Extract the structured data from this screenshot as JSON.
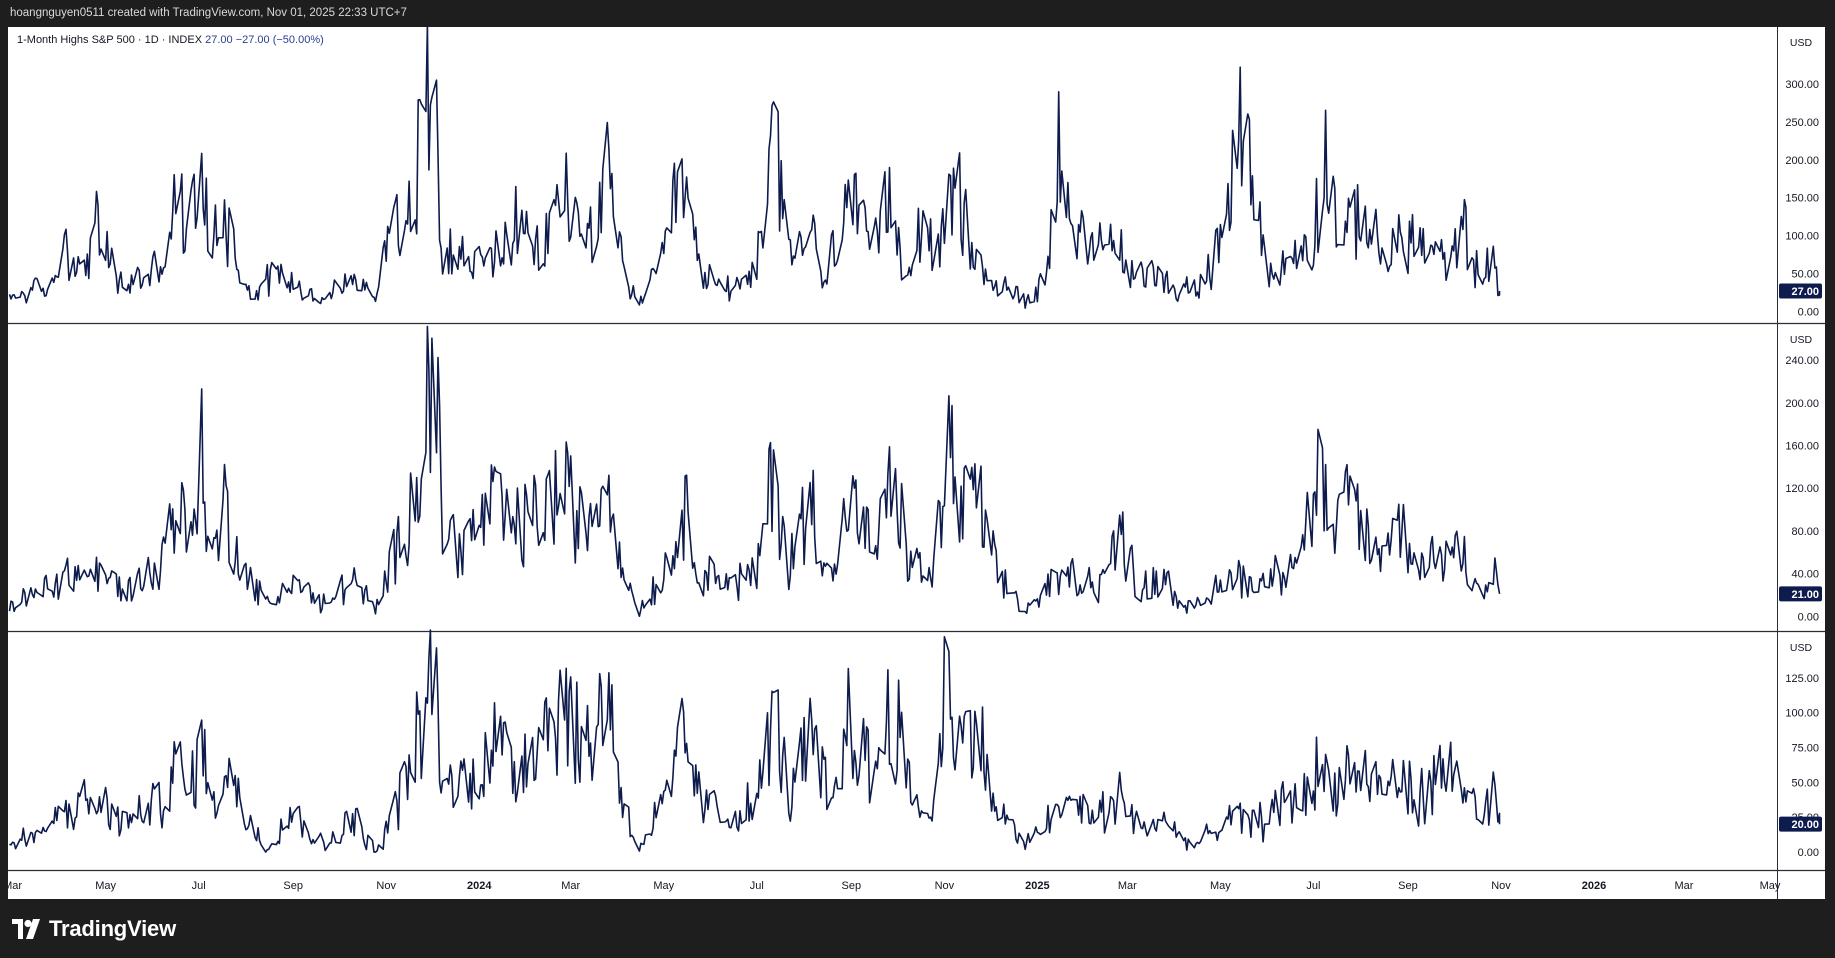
{
  "header": {
    "attribution": "hoangnguyen0511 created with TradingView.com, Nov 01, 2025 22:33 UTC+7"
  },
  "legend": {
    "symbol": "1-Month Highs S&P 500 · 1D · INDEX",
    "last": "27.00",
    "change": "−27.00 (−50.00%)"
  },
  "footer": {
    "brand": "TradingView"
  },
  "colors": {
    "line": "#0d1b4d",
    "price_badge": "#0d1b4d",
    "price_badge_text": "#ffffff",
    "axis_text": "#131722",
    "divider": "#2a2e39",
    "background": "#ffffff",
    "frame": "#1e1e1e"
  },
  "x_axis": {
    "labels": [
      "Mar",
      "May",
      "Jul",
      "Sep",
      "Nov",
      "2024",
      "Mar",
      "May",
      "Jul",
      "Sep",
      "Nov",
      "2025",
      "Mar",
      "May",
      "Jul",
      "Sep",
      "Nov",
      "2026",
      "Mar",
      "May"
    ],
    "bold": [
      "2024",
      "2025",
      "2026"
    ]
  },
  "chart_data": [
    {
      "type": "line",
      "title": "1-Month Highs S&P 500 · 1D · INDEX",
      "currency": "USD",
      "last_value": 27.0,
      "last_value_label": "27.00",
      "ylim": [
        -10,
        370
      ],
      "y_ticks": [
        0,
        50,
        100,
        150,
        200,
        250,
        300
      ],
      "y_tick_labels": [
        "0.00",
        "50.00",
        "100.00",
        "150.00",
        "200.00",
        "250.00",
        "300.00"
      ],
      "anchors": [
        [
          "2023-02-26",
          15
        ],
        [
          "2023-03-12",
          30
        ],
        [
          "2023-03-25",
          25
        ],
        [
          "2023-04-05",
          95
        ],
        [
          "2023-04-15",
          45
        ],
        [
          "2023-04-25",
          110
        ],
        [
          "2023-05-10",
          35
        ],
        [
          "2023-05-28",
          45
        ],
        [
          "2023-06-10",
          75
        ],
        [
          "2023-06-17",
          155
        ],
        [
          "2023-06-25",
          90
        ],
        [
          "2023-07-02",
          240
        ],
        [
          "2023-07-08",
          60
        ],
        [
          "2023-07-15",
          150
        ],
        [
          "2023-07-25",
          75
        ],
        [
          "2023-08-05",
          20
        ],
        [
          "2023-08-20",
          55
        ],
        [
          "2023-09-05",
          30
        ],
        [
          "2023-09-20",
          15
        ],
        [
          "2023-10-10",
          45
        ],
        [
          "2023-10-25",
          15
        ],
        [
          "2023-11-05",
          150
        ],
        [
          "2023-11-15",
          110
        ],
        [
          "2023-11-25",
          240
        ],
        [
          "2023-12-02",
          350
        ],
        [
          "2023-12-08",
          90
        ],
        [
          "2023-12-20",
          70
        ],
        [
          "2024-01-05",
          60
        ],
        [
          "2024-01-25",
          110
        ],
        [
          "2024-02-10",
          70
        ],
        [
          "2024-02-25",
          165
        ],
        [
          "2024-03-10",
          90
        ],
        [
          "2024-03-25",
          170
        ],
        [
          "2024-04-05",
          50
        ],
        [
          "2024-04-15",
          10
        ],
        [
          "2024-05-01",
          65
        ],
        [
          "2024-05-12",
          180
        ],
        [
          "2024-05-25",
          50
        ],
        [
          "2024-06-10",
          30
        ],
        [
          "2024-06-25",
          45
        ],
        [
          "2024-07-05",
          85
        ],
        [
          "2024-07-13",
          245
        ],
        [
          "2024-07-22",
          65
        ],
        [
          "2024-08-05",
          110
        ],
        [
          "2024-08-15",
          30
        ],
        [
          "2024-08-28",
          160
        ],
        [
          "2024-09-15",
          70
        ],
        [
          "2024-09-28",
          160
        ],
        [
          "2024-10-05",
          50
        ],
        [
          "2024-10-18",
          120
        ],
        [
          "2024-10-30",
          80
        ],
        [
          "2024-11-08",
          170
        ],
        [
          "2024-11-22",
          60
        ],
        [
          "2024-12-10",
          30
        ],
        [
          "2024-12-28",
          15
        ],
        [
          "2025-01-08",
          60
        ],
        [
          "2025-01-16",
          245
        ],
        [
          "2025-01-25",
          110
        ],
        [
          "2025-02-05",
          70
        ],
        [
          "2025-02-20",
          100
        ],
        [
          "2025-03-05",
          40
        ],
        [
          "2025-03-20",
          55
        ],
        [
          "2025-04-05",
          25
        ],
        [
          "2025-04-20",
          40
        ],
        [
          "2025-05-05",
          100
        ],
        [
          "2025-05-15",
          285
        ],
        [
          "2025-05-25",
          120
        ],
        [
          "2025-06-05",
          40
        ],
        [
          "2025-06-20",
          80
        ],
        [
          "2025-07-01",
          95
        ],
        [
          "2025-07-08",
          215
        ],
        [
          "2025-07-20",
          80
        ],
        [
          "2025-08-01",
          140
        ],
        [
          "2025-08-15",
          70
        ],
        [
          "2025-09-01",
          100
        ],
        [
          "2025-09-15",
          80
        ],
        [
          "2025-09-28",
          60
        ],
        [
          "2025-10-08",
          105
        ],
        [
          "2025-10-18",
          45
        ],
        [
          "2025-10-26",
          65
        ],
        [
          "2025-10-31",
          27
        ]
      ]
    },
    {
      "type": "line",
      "currency": "USD",
      "last_value": 21.0,
      "last_value_label": "21.00",
      "ylim": [
        -10,
        270
      ],
      "y_ticks": [
        0,
        40,
        80,
        120,
        160,
        200,
        240
      ],
      "y_tick_labels": [
        "0.00",
        "40.00",
        "80.00",
        "120.00",
        "160.00",
        "200.00",
        "240.00"
      ],
      "anchors": [
        [
          "2023-02-26",
          10
        ],
        [
          "2023-03-15",
          20
        ],
        [
          "2023-04-05",
          40
        ],
        [
          "2023-04-25",
          40
        ],
        [
          "2023-05-15",
          25
        ],
        [
          "2023-06-05",
          45
        ],
        [
          "2023-06-17",
          115
        ],
        [
          "2023-06-25",
          60
        ],
        [
          "2023-07-02",
          160
        ],
        [
          "2023-07-10",
          50
        ],
        [
          "2023-07-18",
          105
        ],
        [
          "2023-08-01",
          40
        ],
        [
          "2023-08-15",
          10
        ],
        [
          "2023-09-01",
          35
        ],
        [
          "2023-09-20",
          10
        ],
        [
          "2023-10-10",
          35
        ],
        [
          "2023-10-25",
          5
        ],
        [
          "2023-11-10",
          70
        ],
        [
          "2023-11-25",
          150
        ],
        [
          "2023-12-02",
          265
        ],
        [
          "2023-12-08",
          80
        ],
        [
          "2023-12-25",
          70
        ],
        [
          "2024-01-10",
          105
        ],
        [
          "2024-01-25",
          80
        ],
        [
          "2024-02-10",
          100
        ],
        [
          "2024-02-25",
          120
        ],
        [
          "2024-03-10",
          80
        ],
        [
          "2024-03-25",
          135
        ],
        [
          "2024-04-05",
          40
        ],
        [
          "2024-04-15",
          5
        ],
        [
          "2024-05-05",
          50
        ],
        [
          "2024-05-14",
          100
        ],
        [
          "2024-05-25",
          45
        ],
        [
          "2024-06-15",
          30
        ],
        [
          "2024-07-01",
          40
        ],
        [
          "2024-07-12",
          140
        ],
        [
          "2024-07-22",
          45
        ],
        [
          "2024-08-05",
          110
        ],
        [
          "2024-08-20",
          35
        ],
        [
          "2024-08-30",
          110
        ],
        [
          "2024-09-15",
          60
        ],
        [
          "2024-09-28",
          120
        ],
        [
          "2024-10-10",
          50
        ],
        [
          "2024-10-25",
          35
        ],
        [
          "2024-11-03",
          170
        ],
        [
          "2024-11-12",
          90
        ],
        [
          "2024-11-20",
          125
        ],
        [
          "2024-12-05",
          40
        ],
        [
          "2024-12-25",
          5
        ],
        [
          "2025-01-10",
          30
        ],
        [
          "2025-01-25",
          40
        ],
        [
          "2025-02-10",
          30
        ],
        [
          "2025-02-25",
          75
        ],
        [
          "2025-03-10",
          25
        ],
        [
          "2025-03-25",
          40
        ],
        [
          "2025-04-08",
          5
        ],
        [
          "2025-04-25",
          20
        ],
        [
          "2025-05-10",
          40
        ],
        [
          "2025-05-25",
          30
        ],
        [
          "2025-06-10",
          45
        ],
        [
          "2025-06-25",
          70
        ],
        [
          "2025-07-05",
          140
        ],
        [
          "2025-07-14",
          60
        ],
        [
          "2025-07-25",
          120
        ],
        [
          "2025-08-10",
          55
        ],
        [
          "2025-08-25",
          85
        ],
        [
          "2025-09-10",
          50
        ],
        [
          "2025-09-25",
          60
        ],
        [
          "2025-10-08",
          60
        ],
        [
          "2025-10-18",
          20
        ],
        [
          "2025-10-28",
          45
        ],
        [
          "2025-10-31",
          21
        ]
      ]
    },
    {
      "type": "line",
      "currency": "USD",
      "last_value": 20.0,
      "last_value_label": "20.00",
      "ylim": [
        -10,
        155
      ],
      "y_ticks": [
        0,
        25,
        50,
        75,
        100,
        125
      ],
      "y_tick_labels": [
        "0.00",
        "25.00",
        "50.00",
        "75.00",
        "100.00",
        "125.00"
      ],
      "anchors": [
        [
          "2023-02-26",
          5
        ],
        [
          "2023-03-15",
          10
        ],
        [
          "2023-04-05",
          30
        ],
        [
          "2023-04-25",
          35
        ],
        [
          "2023-05-15",
          20
        ],
        [
          "2023-06-05",
          35
        ],
        [
          "2023-06-17",
          65
        ],
        [
          "2023-06-25",
          35
        ],
        [
          "2023-07-02",
          85
        ],
        [
          "2023-07-10",
          30
        ],
        [
          "2023-07-18",
          65
        ],
        [
          "2023-08-01",
          25
        ],
        [
          "2023-08-15",
          5
        ],
        [
          "2023-09-01",
          30
        ],
        [
          "2023-09-20",
          5
        ],
        [
          "2023-10-10",
          25
        ],
        [
          "2023-10-25",
          0
        ],
        [
          "2023-11-10",
          40
        ],
        [
          "2023-11-25",
          90
        ],
        [
          "2023-12-02",
          140
        ],
        [
          "2023-12-08",
          50
        ],
        [
          "2023-12-25",
          50
        ],
        [
          "2024-01-10",
          80
        ],
        [
          "2024-01-25",
          60
        ],
        [
          "2024-02-10",
          90
        ],
        [
          "2024-02-25",
          110
        ],
        [
          "2024-03-10",
          70
        ],
        [
          "2024-03-25",
          120
        ],
        [
          "2024-04-05",
          30
        ],
        [
          "2024-04-15",
          5
        ],
        [
          "2024-05-05",
          40
        ],
        [
          "2024-05-14",
          85
        ],
        [
          "2024-05-25",
          35
        ],
        [
          "2024-06-15",
          25
        ],
        [
          "2024-07-01",
          35
        ],
        [
          "2024-07-12",
          100
        ],
        [
          "2024-07-22",
          40
        ],
        [
          "2024-08-05",
          80
        ],
        [
          "2024-08-20",
          30
        ],
        [
          "2024-08-30",
          95
        ],
        [
          "2024-09-15",
          55
        ],
        [
          "2024-09-28",
          110
        ],
        [
          "2024-10-10",
          40
        ],
        [
          "2024-10-25",
          25
        ],
        [
          "2024-11-03",
          142
        ],
        [
          "2024-11-12",
          70
        ],
        [
          "2024-11-20",
          100
        ],
        [
          "2024-12-05",
          30
        ],
        [
          "2024-12-25",
          5
        ],
        [
          "2025-01-10",
          25
        ],
        [
          "2025-01-25",
          35
        ],
        [
          "2025-02-10",
          25
        ],
        [
          "2025-02-25",
          40
        ],
        [
          "2025-03-10",
          15
        ],
        [
          "2025-03-25",
          25
        ],
        [
          "2025-04-08",
          5
        ],
        [
          "2025-04-25",
          10
        ],
        [
          "2025-05-10",
          25
        ],
        [
          "2025-05-25",
          20
        ],
        [
          "2025-06-10",
          35
        ],
        [
          "2025-06-25",
          40
        ],
        [
          "2025-07-05",
          60
        ],
        [
          "2025-07-14",
          45
        ],
        [
          "2025-07-25",
          60
        ],
        [
          "2025-08-10",
          45
        ],
        [
          "2025-08-25",
          50
        ],
        [
          "2025-09-10",
          40
        ],
        [
          "2025-09-25",
          55
        ],
        [
          "2025-10-08",
          55
        ],
        [
          "2025-10-18",
          20
        ],
        [
          "2025-10-28",
          40
        ],
        [
          "2025-10-31",
          20
        ]
      ]
    }
  ]
}
